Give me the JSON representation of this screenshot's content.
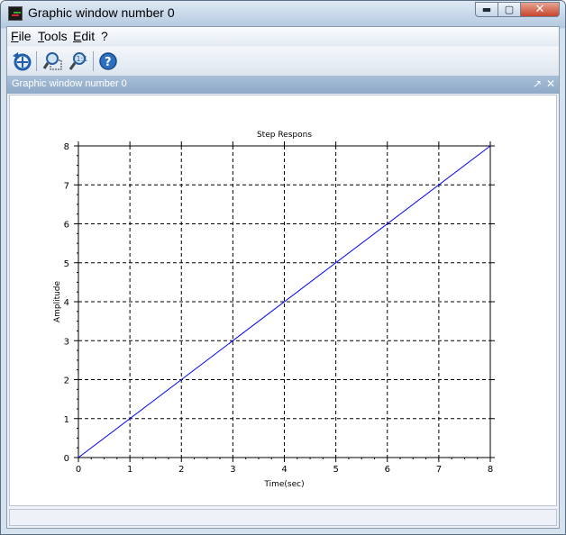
{
  "window": {
    "title": "Graphic window number 0"
  },
  "menu": [
    {
      "label": "File"
    },
    {
      "label": "Tools"
    },
    {
      "label": "Edit"
    },
    {
      "label": "?"
    }
  ],
  "toolbar": [
    {
      "icon": "rotate-icon"
    },
    {
      "icon": "zoom-icon"
    },
    {
      "icon": "unzoom-icon"
    },
    {
      "icon": "help-icon"
    }
  ],
  "panel": {
    "title": "Graphic window number 0"
  },
  "chart_data": {
    "type": "line",
    "title": "Step Respons",
    "xlabel": "Time(sec)",
    "ylabel": "Amplitude",
    "xlim": [
      0,
      8
    ],
    "ylim": [
      0,
      8
    ],
    "xticks": [
      0,
      1,
      2,
      3,
      4,
      5,
      6,
      7,
      8
    ],
    "yticks": [
      0,
      1,
      2,
      3,
      4,
      5,
      6,
      7,
      8
    ],
    "grid": true,
    "line_color": "#0000ff",
    "series": [
      {
        "x": [
          0,
          8
        ],
        "y": [
          0,
          8
        ]
      }
    ]
  }
}
